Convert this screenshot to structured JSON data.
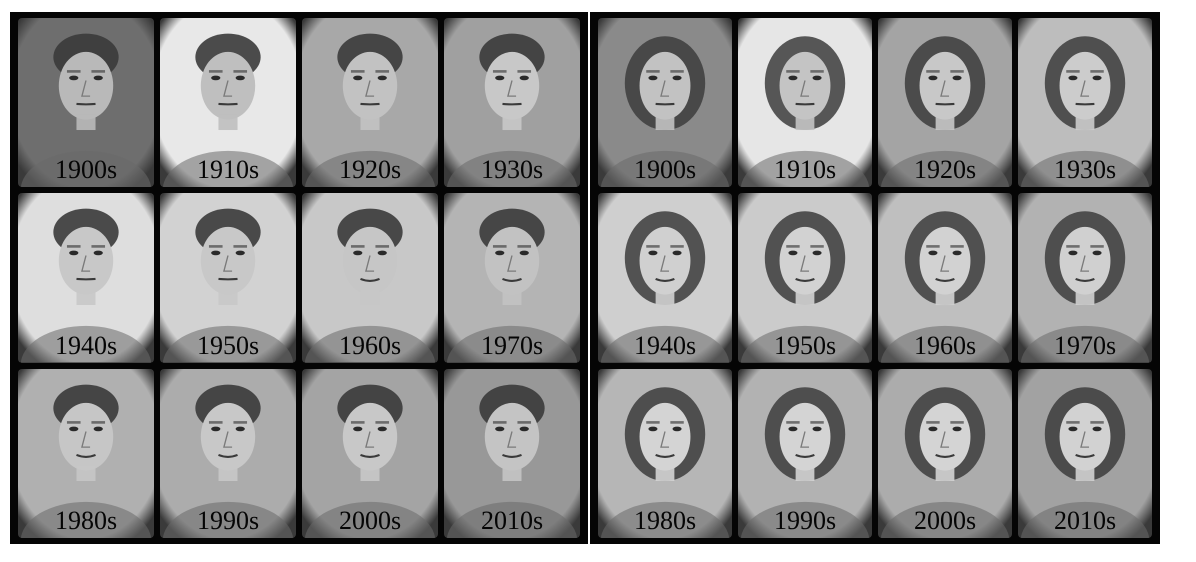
{
  "panels": [
    {
      "id": "men",
      "cells": [
        {
          "decade": "1900s",
          "tone": "#6e6e6e",
          "face": "#b9b9b9"
        },
        {
          "decade": "1910s",
          "tone": "#e8e8e8",
          "face": "#bfbfbf"
        },
        {
          "decade": "1920s",
          "tone": "#a8a8a8",
          "face": "#c2c2c2"
        },
        {
          "decade": "1930s",
          "tone": "#a0a0a0",
          "face": "#c8c8c8"
        },
        {
          "decade": "1940s",
          "tone": "#dedede",
          "face": "#c8c8c8"
        },
        {
          "decade": "1950s",
          "tone": "#d2d2d2",
          "face": "#c8c8c8"
        },
        {
          "decade": "1960s",
          "tone": "#c8c8c8",
          "face": "#c6c6c6"
        },
        {
          "decade": "1970s",
          "tone": "#b4b4b4",
          "face": "#c2c2c2"
        },
        {
          "decade": "1980s",
          "tone": "#b0b0b0",
          "face": "#c6c6c6"
        },
        {
          "decade": "1990s",
          "tone": "#acacac",
          "face": "#c8c8c8"
        },
        {
          "decade": "2000s",
          "tone": "#a4a4a4",
          "face": "#c8c8c8"
        },
        {
          "decade": "2010s",
          "tone": "#989898",
          "face": "#c4c4c4"
        }
      ]
    },
    {
      "id": "women",
      "cells": [
        {
          "decade": "1900s",
          "tone": "#8a8a8a",
          "face": "#c2c2c2"
        },
        {
          "decade": "1910s",
          "tone": "#e6e6e6",
          "face": "#c4c4c4"
        },
        {
          "decade": "1920s",
          "tone": "#a4a4a4",
          "face": "#c8c8c8"
        },
        {
          "decade": "1930s",
          "tone": "#bdbdbd",
          "face": "#cccccc"
        },
        {
          "decade": "1940s",
          "tone": "#cfcfcf",
          "face": "#d0d0d0"
        },
        {
          "decade": "1950s",
          "tone": "#cbcbcb",
          "face": "#d2d2d2"
        },
        {
          "decade": "1960s",
          "tone": "#bfbfbf",
          "face": "#d2d2d2"
        },
        {
          "decade": "1970s",
          "tone": "#b2b2b2",
          "face": "#d0d0d0"
        },
        {
          "decade": "1980s",
          "tone": "#b6b6b6",
          "face": "#d4d4d4"
        },
        {
          "decade": "1990s",
          "tone": "#b2b2b2",
          "face": "#d4d4d4"
        },
        {
          "decade": "2000s",
          "tone": "#acacac",
          "face": "#d4d4d4"
        },
        {
          "decade": "2010s",
          "tone": "#a2a2a2",
          "face": "#d2d2d2"
        }
      ]
    }
  ]
}
